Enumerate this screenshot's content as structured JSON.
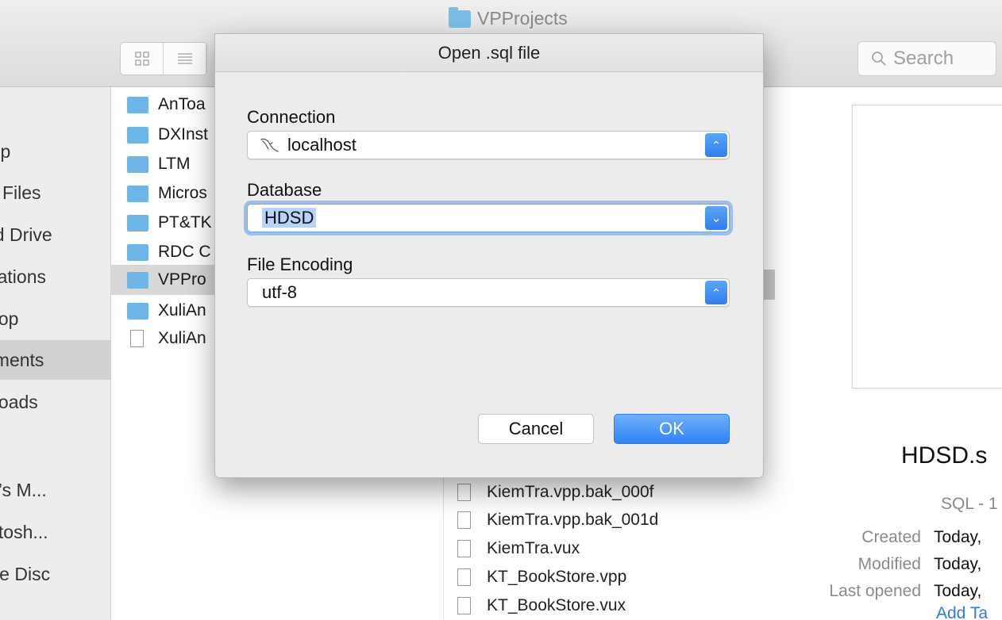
{
  "window": {
    "title": "VPProjects"
  },
  "toolbar": {
    "search_placeholder": "Search"
  },
  "sidebar": {
    "items": [
      {
        "label": "rop",
        "selected": false
      },
      {
        "label": "ly Files",
        "selected": false
      },
      {
        "label": "ud Drive",
        "selected": false
      },
      {
        "label": "ications",
        "selected": false
      },
      {
        "label": "ktop",
        "selected": false
      },
      {
        "label": "uments",
        "selected": true
      },
      {
        "label": "nloads",
        "selected": false
      },
      {
        "label": "in’s M...",
        "selected": false
      },
      {
        "label": "intosh...",
        "selected": false
      },
      {
        "label": "ote Disc",
        "selected": false
      }
    ]
  },
  "column1": {
    "items": [
      {
        "label": "AnToa",
        "type": "folder"
      },
      {
        "label": "DXInst",
        "type": "folder"
      },
      {
        "label": "LTM",
        "type": "folder"
      },
      {
        "label": "Micros",
        "type": "folder"
      },
      {
        "label": "PT&TK",
        "type": "folder"
      },
      {
        "label": "RDC C",
        "type": "folder"
      },
      {
        "label": "VPPro",
        "type": "folder",
        "selected": true
      },
      {
        "label": "XuliAn",
        "type": "folder"
      },
      {
        "label": "XuliAn",
        "type": "file"
      }
    ]
  },
  "column2": {
    "items": [
      {
        "label": "KiemTra.vpp.bak_000f"
      },
      {
        "label": "KiemTra.vpp.bak_001d"
      },
      {
        "label": "KiemTra.vux"
      },
      {
        "label": "KT_BookStore.vpp"
      },
      {
        "label": "KT_BookStore.vux"
      }
    ]
  },
  "preview": {
    "name": "HDSD.s",
    "kind": "SQL - 1",
    "created_label": "Created",
    "created_value": "Today,",
    "modified_label": "Modified",
    "modified_value": "Today,",
    "last_opened_label": "Last opened",
    "last_opened_value": "Today,",
    "add_tags": "Add Ta"
  },
  "dialog": {
    "title": "Open .sql file",
    "connection_label": "Connection",
    "connection_value": "localhost",
    "database_label": "Database",
    "database_value": "HDSD",
    "encoding_label": "File Encoding",
    "encoding_value": "utf-8",
    "cancel_label": "Cancel",
    "ok_label": "OK"
  },
  "colors": {
    "accent": "#2f83f5",
    "folder": "#6fb6e8",
    "selection": "#d1d1d1",
    "text_highlight": "#b5d4fb"
  }
}
